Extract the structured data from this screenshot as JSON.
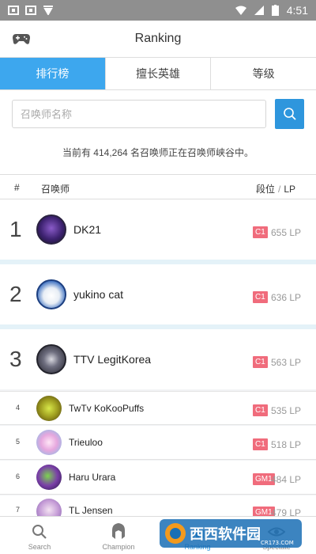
{
  "status_bar": {
    "time": "4:51"
  },
  "app_bar": {
    "title": "Ranking"
  },
  "tabs": [
    {
      "label": "排行榜",
      "active": true
    },
    {
      "label": "擅长英雄",
      "active": false
    },
    {
      "label": "等级",
      "active": false
    }
  ],
  "search": {
    "placeholder": "召唤师名称",
    "value": ""
  },
  "summary": "当前有 414,264 名召唤师正在召唤师峡谷中。",
  "table_header": {
    "rank": "#",
    "name": "召唤师",
    "tier": "段位",
    "lp": "LP"
  },
  "rows": [
    {
      "rank": "1",
      "name": "DK21",
      "tier": "C1",
      "lp": "655 LP"
    },
    {
      "rank": "2",
      "name": "yukino cat",
      "tier": "C1",
      "lp": "636 LP"
    },
    {
      "rank": "3",
      "name": "TTV LegitKorea",
      "tier": "C1",
      "lp": "563 LP"
    },
    {
      "rank": "4",
      "name": "TwTv KoKooPuffs",
      "tier": "C1",
      "lp": "535 LP"
    },
    {
      "rank": "5",
      "name": "Trieuloo",
      "tier": "C1",
      "lp": "518 LP"
    },
    {
      "rank": "6",
      "name": "Haru Urara",
      "tier": "GM1",
      "lp": "484 LP"
    },
    {
      "rank": "7",
      "name": "TL Jensen",
      "tier": "GM1",
      "lp": "479 LP"
    }
  ],
  "bottom_nav": [
    {
      "label": "Search",
      "icon": "search-icon",
      "active": false
    },
    {
      "label": "Champion",
      "icon": "champion-helmet-icon",
      "active": false
    },
    {
      "label": "Ranking",
      "icon": "ranking-icon",
      "active": true
    },
    {
      "label": "Spectate",
      "icon": "spectate-icon",
      "active": false
    }
  ],
  "watermark": {
    "text": "西西软件园",
    "sub": "CR173.COM"
  },
  "colors": {
    "accent": "#3da7ee",
    "tier_badge": "#f06c7c",
    "band": "#e4f2f8"
  }
}
